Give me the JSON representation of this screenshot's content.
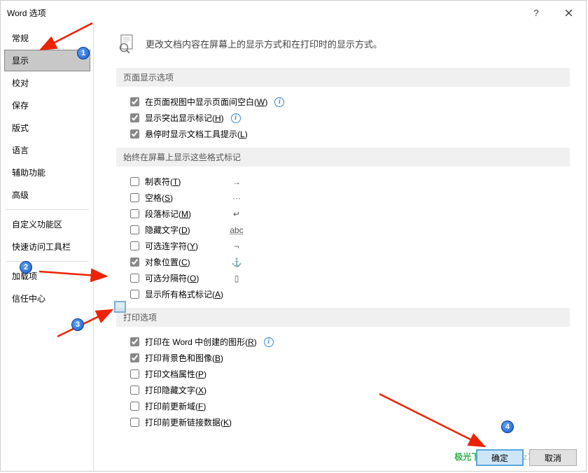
{
  "title": "Word 选项",
  "sidebar": {
    "items": [
      {
        "label": "常规"
      },
      {
        "label": "显示"
      },
      {
        "label": "校对"
      },
      {
        "label": "保存"
      },
      {
        "label": "版式"
      },
      {
        "label": "语言"
      },
      {
        "label": "辅助功能"
      },
      {
        "label": "高级"
      },
      {
        "label": "自定义功能区"
      },
      {
        "label": "快速访问工具栏"
      },
      {
        "label": "加载项"
      },
      {
        "label": "信任中心"
      }
    ],
    "selected_index": 1
  },
  "header": {
    "text": "更改文档内容在屏幕上的显示方式和在打印时的显示方式。"
  },
  "sections": {
    "page_display": {
      "title": "页面显示选项",
      "opts": [
        {
          "label": "在页面视图中显示页面间空白(",
          "u": "W",
          "suffix": ")",
          "checked": true,
          "info": true
        },
        {
          "label": "显示突出显示标记(",
          "u": "H",
          "suffix": ")",
          "checked": true,
          "info": true
        },
        {
          "label": "悬停时显示文档工具提示(",
          "u": "L",
          "suffix": ")",
          "checked": true
        }
      ]
    },
    "format_marks": {
      "title": "始终在屏幕上显示这些格式标记",
      "opts": [
        {
          "label": "制表符(",
          "u": "T",
          "suffix": ")",
          "checked": false,
          "sym": "→"
        },
        {
          "label": "空格(",
          "u": "S",
          "suffix": ")",
          "checked": false,
          "sym": "···"
        },
        {
          "label": "段落标记(",
          "u": "M",
          "suffix": ")",
          "checked": false,
          "sym": "↵"
        },
        {
          "label": "隐藏文字(",
          "u": "D",
          "suffix": ")",
          "checked": false,
          "sym": "abc"
        },
        {
          "label": "可选连字符(",
          "u": "Y",
          "suffix": ")",
          "checked": false,
          "sym": "¬"
        },
        {
          "label": "对象位置(",
          "u": "C",
          "suffix": ")",
          "checked": true,
          "sym": "⚓"
        },
        {
          "label": "可选分隔符(",
          "u": "O",
          "suffix": ")",
          "checked": false,
          "sym": "▯"
        },
        {
          "label": "显示所有格式标记(",
          "u": "A",
          "suffix": ")",
          "checked": false
        }
      ]
    },
    "print": {
      "title": "打印选项",
      "opts": [
        {
          "label": "打印在 Word 中创建的图形(",
          "u": "R",
          "suffix": ")",
          "checked": true,
          "info": true
        },
        {
          "label": "打印背景色和图像(",
          "u": "B",
          "suffix": ")",
          "checked": true
        },
        {
          "label": "打印文档属性(",
          "u": "P",
          "suffix": ")",
          "checked": false
        },
        {
          "label": "打印隐藏文字(",
          "u": "X",
          "suffix": ")",
          "checked": false
        },
        {
          "label": "打印前更新域(",
          "u": "F",
          "suffix": ")",
          "checked": false
        },
        {
          "label": "打印前更新链接数据(",
          "u": "K",
          "suffix": ")",
          "checked": false
        }
      ]
    }
  },
  "footer": {
    "ok": "确定",
    "cancel": "取消"
  },
  "markers": [
    "1",
    "2",
    "3",
    "4"
  ],
  "watermark": {
    "brand": "极光下载站",
    "url": "www.xz7.com"
  }
}
